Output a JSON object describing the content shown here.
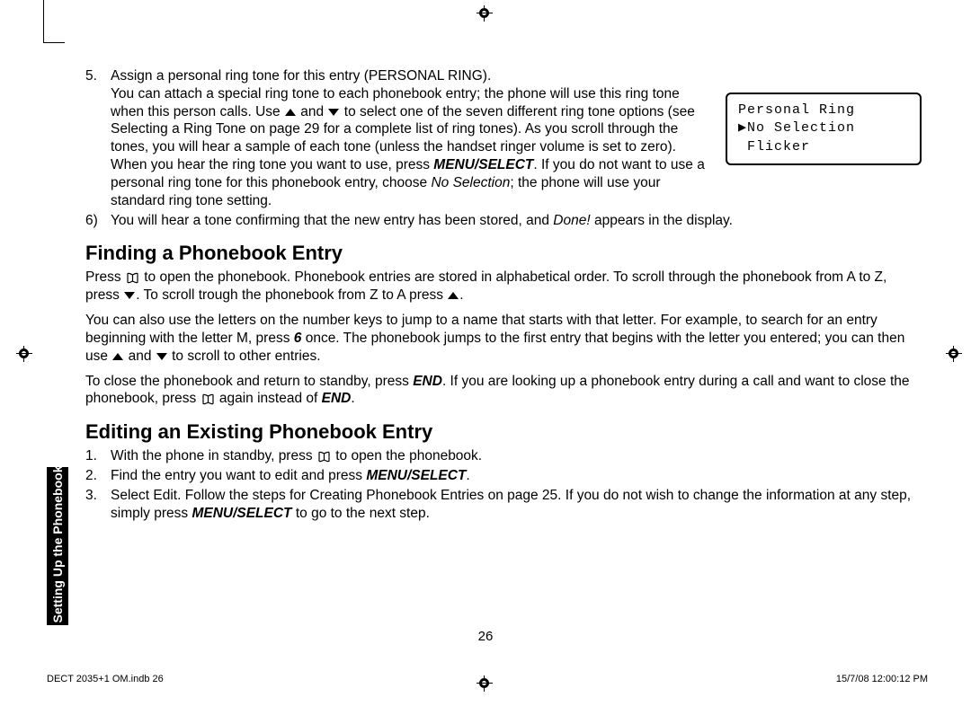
{
  "lcd": {
    "line1": "Personal Ring",
    "line2": "▶No Selection",
    "line3": " Flicker"
  },
  "step5": {
    "num": "5.",
    "lead": "Assign a personal ring tone for this entry (PERSONAL RING).",
    "body_a": "You can attach a special ring tone to each phonebook entry; the phone will use this ring tone when this person calls. Use ",
    "body_b": " and ",
    "body_c": " to select one of the seven different ring tone options (see Selecting a Ring Tone on page 29 for a complete list of ring tones). As you scroll through the tones, you will hear a sample of each tone (unless the handset ringer volume is set to zero). When you hear the ring tone you want to use, press ",
    "menu_select": "MENU/SELECT",
    "body_d": ". If you do not want to use a personal ring tone for this phonebook entry, choose ",
    "no_selection": "No Selection",
    "body_e": "; the phone will use your standard ring tone setting."
  },
  "step6": {
    "num": "6)",
    "a": "You will hear a tone confirming that the new entry has been stored, and ",
    "done": "Done!",
    "b": " appears in the display."
  },
  "h_find": "Finding a Phonebook Entry",
  "find_p1": {
    "a": "Press ",
    "b": " to open the phonebook. Phonebook entries are stored in alphabetical order. To scroll through the phonebook from A to Z, press ",
    "c": ". To scroll trough the phonebook from Z to A press ",
    "d": "."
  },
  "find_p2": {
    "a": "You can also use the letters on the number keys to jump to a name that starts with that letter. For example, to search for an entry beginning with the letter M, press ",
    "six": "6",
    "b": " once. The phonebook jumps to the first entry that begins with the letter you entered; you can then use ",
    "c": " and ",
    "d": " to scroll to other entries."
  },
  "find_p3": {
    "a": "To close the phonebook and return to standby, press ",
    "end": "END",
    "b": ". If you are looking up a phonebook entry during a call and want to close the phonebook, press ",
    "c": " again instead of ",
    "d": "."
  },
  "h_edit": "Editing an Existing Phonebook Entry",
  "edit1": {
    "num": "1.",
    "a": "With the phone in standby, press ",
    "b": " to open the phonebook."
  },
  "edit2": {
    "num": "2.",
    "a": "Find the entry you want to edit and press ",
    "ms": "MENU/SELECT",
    "b": "."
  },
  "edit3": {
    "num": "3.",
    "a": "Select Edit. Follow the steps for Creating Phonebook Entries on page 25. If you do not wish to change the information at any step, simply press ",
    "ms": "MENU/SELECT",
    "b": " to go to the next step."
  },
  "side_tab": "Setting Up the Phonebook",
  "page_number": "26",
  "footer_left": "DECT 2035+1 OM.indb   26",
  "footer_right": "15/7/08   12:00:12 PM"
}
